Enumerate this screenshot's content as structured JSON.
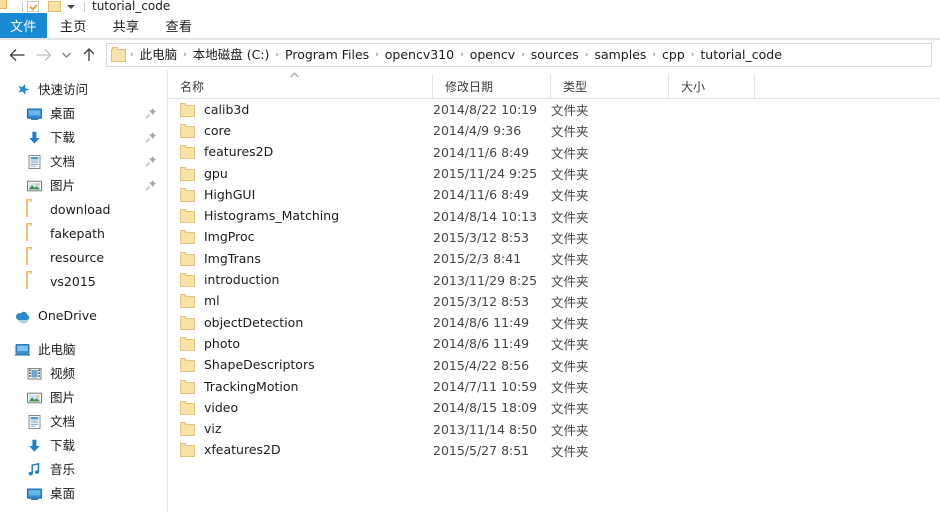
{
  "window": {
    "title": "tutorial_code",
    "qat": {
      "check_icon": "check-box-icon",
      "folder_icon": "folder-icon",
      "dropdown_icon": "chevron-down-icon"
    }
  },
  "ribbon": {
    "tabs": [
      {
        "label": "文件",
        "active": true
      },
      {
        "label": "主页",
        "active": false
      },
      {
        "label": "共享",
        "active": false
      },
      {
        "label": "查看",
        "active": false
      }
    ],
    "active_tab_color": "#1a8ad4"
  },
  "navigation": {
    "back_icon": "arrow-left-icon",
    "forward_icon": "arrow-right-icon",
    "recent_icon": "chevron-down-icon",
    "up_icon": "arrow-up-icon",
    "breadcrumb": {
      "folder_icon": "folder-icon",
      "separator": "›",
      "items": [
        "此电脑",
        "本地磁盘 (C:)",
        "Program Files",
        "opencv310",
        "opencv",
        "sources",
        "samples",
        "cpp",
        "tutorial_code"
      ]
    }
  },
  "sidebar": {
    "groups": [
      {
        "name": "quick-access",
        "header": {
          "label": "快速访问",
          "icon": "star-icon"
        },
        "items": [
          {
            "label": "桌面",
            "icon": "desktop-icon",
            "pinned": true
          },
          {
            "label": "下载",
            "icon": "download-icon",
            "pinned": true
          },
          {
            "label": "文档",
            "icon": "documents-icon",
            "pinned": true
          },
          {
            "label": "图片",
            "icon": "pictures-icon",
            "pinned": true
          },
          {
            "label": "download",
            "icon": "folder-icon",
            "pinned": false
          },
          {
            "label": "fakepath",
            "icon": "folder-icon",
            "pinned": false
          },
          {
            "label": "resource",
            "icon": "folder-icon",
            "pinned": false
          },
          {
            "label": "vs2015",
            "icon": "folder-icon",
            "pinned": false
          }
        ]
      },
      {
        "name": "onedrive",
        "header": {
          "label": "OneDrive",
          "icon": "cloud-icon"
        },
        "items": []
      },
      {
        "name": "this-pc",
        "header": {
          "label": "此电脑",
          "icon": "computer-icon"
        },
        "items": [
          {
            "label": "视频",
            "icon": "videos-icon",
            "pinned": false
          },
          {
            "label": "图片",
            "icon": "pictures-icon",
            "pinned": false
          },
          {
            "label": "文档",
            "icon": "documents-icon",
            "pinned": false
          },
          {
            "label": "下载",
            "icon": "download-icon",
            "pinned": false
          },
          {
            "label": "音乐",
            "icon": "music-icon",
            "pinned": false
          },
          {
            "label": "桌面",
            "icon": "desktop-icon",
            "pinned": false
          }
        ]
      }
    ]
  },
  "filelist": {
    "columns": [
      {
        "key": "name",
        "label": "名称",
        "sorted": "asc"
      },
      {
        "key": "date",
        "label": "修改日期",
        "sorted": ""
      },
      {
        "key": "type",
        "label": "类型",
        "sorted": ""
      },
      {
        "key": "size",
        "label": "大小",
        "sorted": ""
      }
    ],
    "sort_indicator_icon": "chevron-up-icon",
    "rows": [
      {
        "name": "calib3d",
        "date": "2014/8/22 10:19",
        "type": "文件夹",
        "size": "",
        "icon": "folder-icon"
      },
      {
        "name": "core",
        "date": "2014/4/9 9:36",
        "type": "文件夹",
        "size": "",
        "icon": "folder-icon"
      },
      {
        "name": "features2D",
        "date": "2014/11/6 8:49",
        "type": "文件夹",
        "size": "",
        "icon": "folder-icon"
      },
      {
        "name": "gpu",
        "date": "2015/11/24 9:25",
        "type": "文件夹",
        "size": "",
        "icon": "folder-icon"
      },
      {
        "name": "HighGUI",
        "date": "2014/11/6 8:49",
        "type": "文件夹",
        "size": "",
        "icon": "folder-icon"
      },
      {
        "name": "Histograms_Matching",
        "date": "2014/8/14 10:13",
        "type": "文件夹",
        "size": "",
        "icon": "folder-icon"
      },
      {
        "name": "ImgProc",
        "date": "2015/3/12 8:53",
        "type": "文件夹",
        "size": "",
        "icon": "folder-icon"
      },
      {
        "name": "ImgTrans",
        "date": "2015/2/3 8:41",
        "type": "文件夹",
        "size": "",
        "icon": "folder-icon"
      },
      {
        "name": "introduction",
        "date": "2013/11/29 8:25",
        "type": "文件夹",
        "size": "",
        "icon": "folder-icon"
      },
      {
        "name": "ml",
        "date": "2015/3/12 8:53",
        "type": "文件夹",
        "size": "",
        "icon": "folder-icon"
      },
      {
        "name": "objectDetection",
        "date": "2014/8/6 11:49",
        "type": "文件夹",
        "size": "",
        "icon": "folder-icon"
      },
      {
        "name": "photo",
        "date": "2014/8/6 11:49",
        "type": "文件夹",
        "size": "",
        "icon": "folder-icon"
      },
      {
        "name": "ShapeDescriptors",
        "date": "2015/4/22 8:56",
        "type": "文件夹",
        "size": "",
        "icon": "folder-icon"
      },
      {
        "name": "TrackingMotion",
        "date": "2014/7/11 10:59",
        "type": "文件夹",
        "size": "",
        "icon": "folder-icon"
      },
      {
        "name": "video",
        "date": "2014/8/15 18:09",
        "type": "文件夹",
        "size": "",
        "icon": "folder-icon"
      },
      {
        "name": "viz",
        "date": "2013/11/14 8:50",
        "type": "文件夹",
        "size": "",
        "icon": "folder-icon"
      },
      {
        "name": "xfeatures2D",
        "date": "2015/5/27 8:51",
        "type": "文件夹",
        "size": "",
        "icon": "folder-icon"
      }
    ]
  }
}
